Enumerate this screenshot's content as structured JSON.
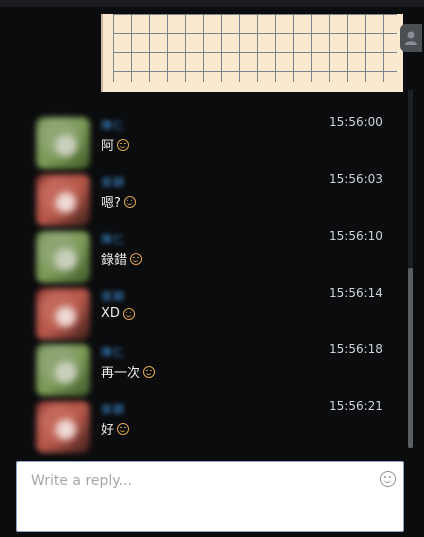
{
  "messages": [
    {
      "sender": "陳仁",
      "time": "15:56:00",
      "text": "阿",
      "avatar": "green"
    },
    {
      "sender": "張穎",
      "time": "15:56:03",
      "text": "嗯?",
      "avatar": "red"
    },
    {
      "sender": "陳仁",
      "time": "15:56:10",
      "text": "錄錯",
      "avatar": "green"
    },
    {
      "sender": "張穎",
      "time": "15:56:14",
      "text": "XD",
      "avatar": "red"
    },
    {
      "sender": "陳仁",
      "time": "15:56:18",
      "text": "再一次",
      "avatar": "green"
    },
    {
      "sender": "張穎",
      "time": "15:56:21",
      "text": "好",
      "avatar": "red"
    }
  ],
  "composer": {
    "placeholder": "Write a reply..."
  },
  "icons": {
    "emoji": "smiley-icon",
    "profile": "user-icon"
  },
  "colors": {
    "sender": "#3d8fd6",
    "emoji": "#e0a64a",
    "background": "#0b0c0e"
  }
}
